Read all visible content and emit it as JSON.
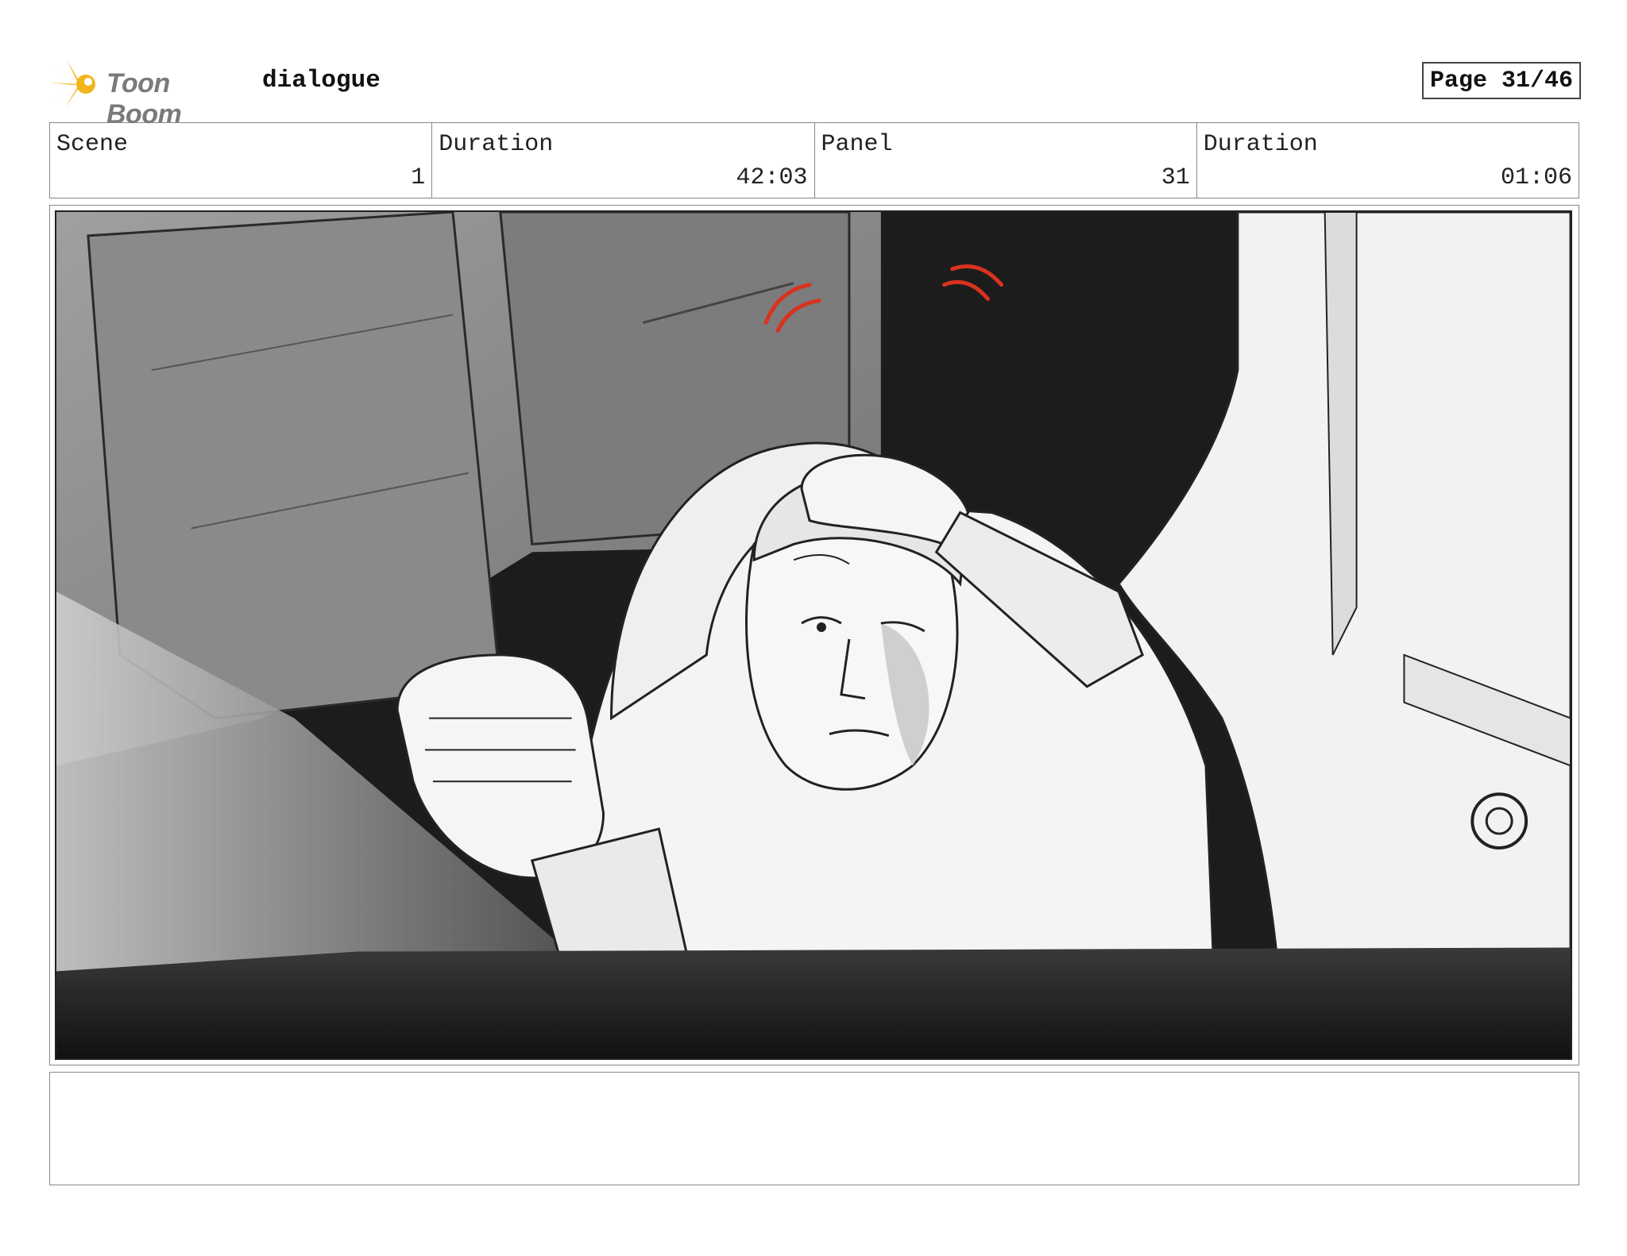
{
  "header": {
    "brand": "Toon Boom",
    "project_title": "dialogue",
    "page_label": "Page 31/46"
  },
  "info": {
    "scene_label": "Scene",
    "scene_value": "1",
    "scene_duration_label": "Duration",
    "scene_duration_value": "42:03",
    "panel_label": "Panel",
    "panel_value": "31",
    "panel_duration_label": "Duration",
    "panel_duration_value": "01:06"
  },
  "colors": {
    "logo_accent": "#f2b51c",
    "motion_lines": "#d9321f",
    "background_dark": "#1c1c1c"
  },
  "notes": {
    "text": ""
  }
}
